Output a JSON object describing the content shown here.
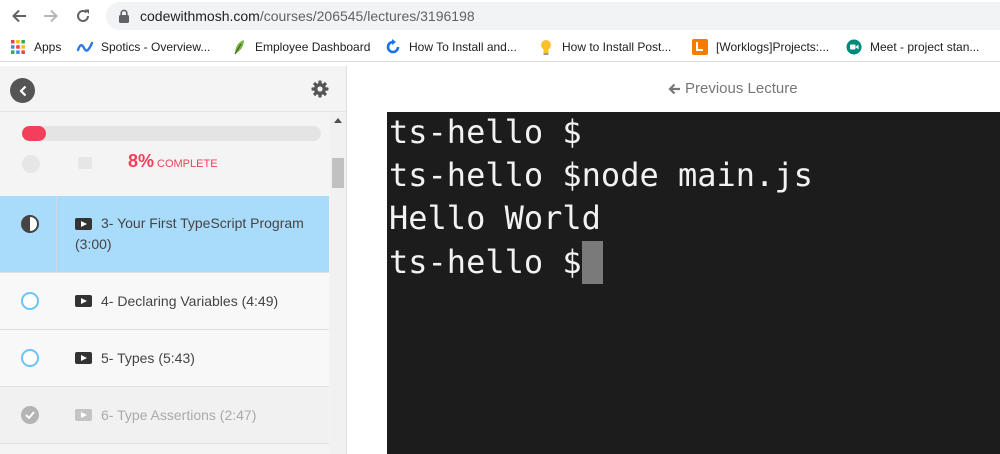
{
  "browser": {
    "url_host": "codewithmosh.com",
    "url_path": "/courses/206545/lectures/3196198",
    "bookmarks": [
      {
        "label": "Apps",
        "icon": "apps-grid-icon"
      },
      {
        "label": "Spotics - Overview...",
        "icon": "spotics-icon"
      },
      {
        "label": "Employee Dashboard",
        "icon": "leaf-icon"
      },
      {
        "label": "How To Install and...",
        "icon": "circle-arrow-icon"
      },
      {
        "label": "How to Install Post...",
        "icon": "lightbulb-icon"
      },
      {
        "label": "[Worklogs]Projects:...",
        "icon": "worklogs-icon"
      },
      {
        "label": "Meet - project stan...",
        "icon": "meet-icon"
      }
    ]
  },
  "sidebar": {
    "progress_fraction": 0.08,
    "progress_percent": "8%",
    "progress_label": "COMPLETE",
    "lectures": [
      {
        "title": "3- Your First TypeScript Program (3:00)",
        "status": "in-progress"
      },
      {
        "title": "4- Declaring Variables (4:49)",
        "status": "not-started"
      },
      {
        "title": "5- Types (5:43)",
        "status": "not-started"
      },
      {
        "title": "6- Type Assertions (2:47)",
        "status": "completed"
      }
    ]
  },
  "main": {
    "prev_label": "Previous Lecture",
    "terminal_lines": [
      "ts-hello $",
      "ts-hello $node main.js",
      "Hello World",
      "ts-hello $"
    ]
  },
  "colors": {
    "accent": "#f33f5a",
    "active_row": "#a9dcfa",
    "status_ring": "#6ec3f5",
    "terminal_bg": "#1c1c1c"
  }
}
